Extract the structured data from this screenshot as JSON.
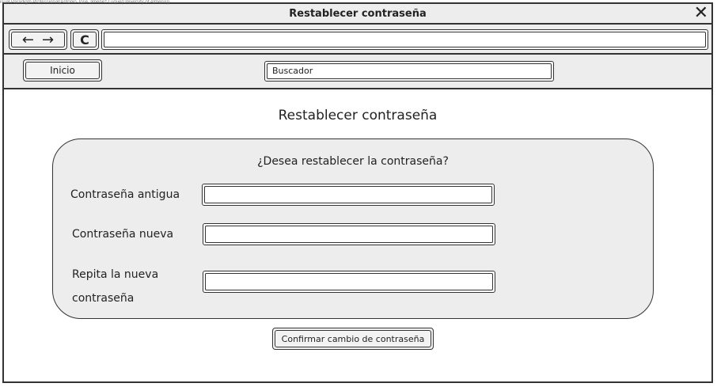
{
  "watermark": "isual Paradigm Professional(Antonio José Jiménez Luque(University of Almeria))",
  "window": {
    "title": "Restablecer contraseña",
    "close_glyph": "✕"
  },
  "nav": {
    "back_glyph": "←",
    "forward_glyph": "→",
    "reload_glyph": "C",
    "address_value": ""
  },
  "toolbar": {
    "home_label": "Inicio",
    "search_value": "Buscador"
  },
  "main": {
    "title": "Restablecer contraseña",
    "question": "¿Desea restablecer la contraseña?",
    "fields": [
      {
        "label": "Contraseña antigua",
        "value": ""
      },
      {
        "label": "Contraseña nueva",
        "value": ""
      },
      {
        "label_line1": "Repita la nueva",
        "label_line2": "contraseña",
        "value": ""
      }
    ],
    "confirm_label": "Confirmar cambio de contraseña"
  }
}
